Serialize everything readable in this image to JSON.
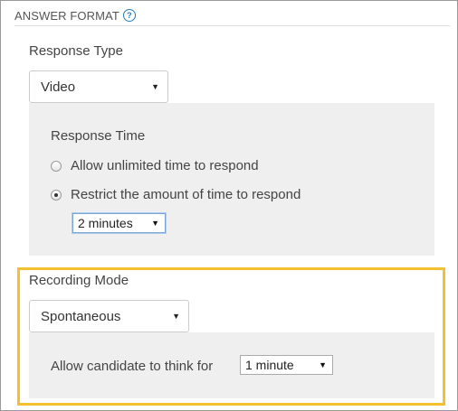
{
  "section": {
    "title": "ANSWER FORMAT",
    "help_icon": "question-circle-icon"
  },
  "response_type": {
    "label": "Response Type",
    "selected": "Video"
  },
  "response_time": {
    "label": "Response Time",
    "options": [
      {
        "label": "Allow unlimited time to respond",
        "checked": false
      },
      {
        "label": "Restrict the amount of time to respond",
        "checked": true
      }
    ],
    "duration_selected": "2 minutes"
  },
  "recording_mode": {
    "label": "Recording Mode",
    "selected": "Spontaneous",
    "think_label": "Allow candidate to think for",
    "think_selected": "1 minute"
  },
  "colors": {
    "highlight": "#f3c030",
    "panel": "#efefef",
    "accent": "#2a7ab8"
  }
}
